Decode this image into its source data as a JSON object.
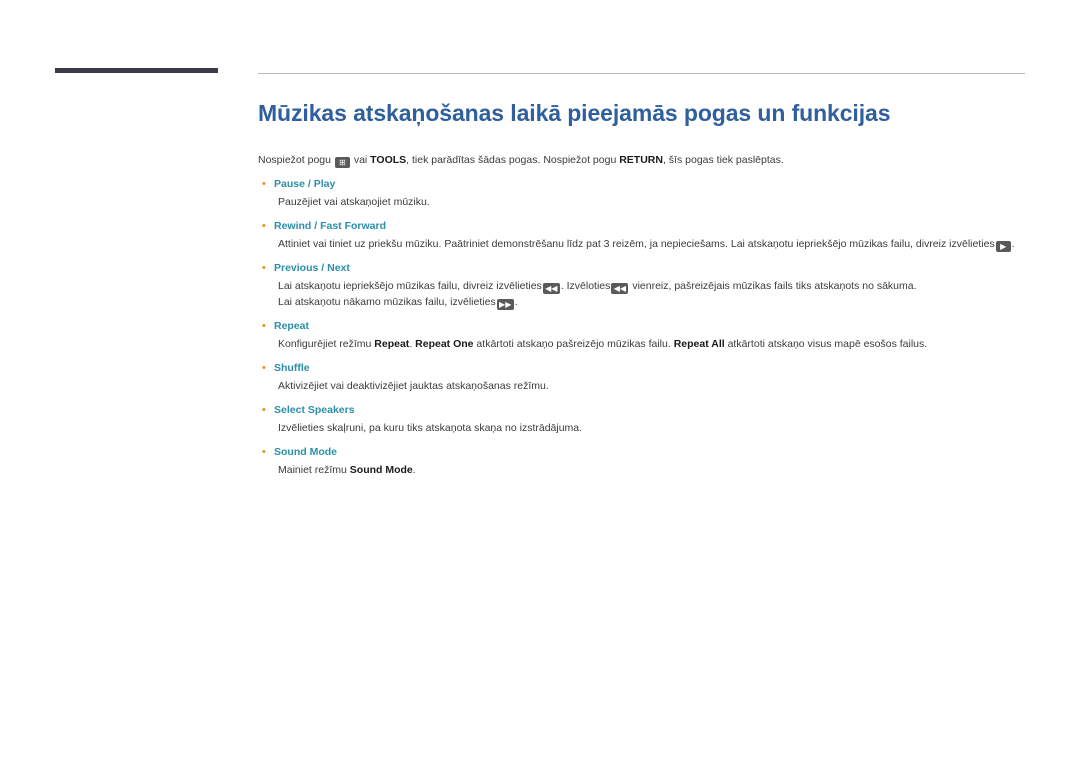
{
  "page": {
    "title": "Mūzikas atskaņošanas laikā pieejamās pogas un funkcijas",
    "intro_before": "Nospiežot pogu",
    "intro_key_1": "⊞",
    "intro_mid_1": "vai",
    "intro_bold_1": "TOOLS",
    "intro_mid_2": ", tiek parādītas šādas pogas. Nospiežot pogu",
    "intro_bold_2": "RETURN",
    "intro_after": ", šīs pogas tiek paslēptas.",
    "bullet_char": "•"
  },
  "items": [
    {
      "title": "Pause / Play",
      "lines": [
        {
          "text": "Pauzējiet vai atskaņojiet mūziku."
        }
      ]
    },
    {
      "title": "Rewind / Fast Forward",
      "lines": [
        {
          "text": "Attiniet vai tiniet uz priekšu mūziku. Paātriniet demonstrēšanu līdz pat 3 reizēm, ja nepieciešams. Lai atskaņotu iepriekšējo mūzikas failu, divreiz izvēlieties",
          "key": "▶",
          "tail": "."
        }
      ]
    },
    {
      "title": "Previous / Next",
      "lines": [
        {
          "text": "Lai atskaņotu iepriekšējo mūzikas failu, divreiz izvēlieties",
          "key": "◀◀",
          "mid": ". Izvēloties",
          "key2": "◀◀",
          "tail": " vienreiz, pašreizējais mūzikas fails tiks atskaņots no sākuma."
        },
        {
          "text": "Lai atskaņotu nākamo mūzikas failu, izvēlieties",
          "key": "▶▶",
          "tail": "."
        }
      ]
    },
    {
      "title": "Repeat",
      "lines": [
        {
          "text": "Konfigurējiet režīmu ",
          "bold1": "Repeat",
          "mid1": ". ",
          "bold2": "Repeat One",
          "mid2": " atkārtoti atskaņo pašreizējo mūzikas failu. ",
          "bold3": "Repeat All",
          "tail": " atkārtoti atskaņo visus mapē esošos failus."
        }
      ]
    },
    {
      "title": "Shuffle",
      "lines": [
        {
          "text": "Aktivizējiet vai deaktivizējiet jauktas atskaņošanas režīmu."
        }
      ]
    },
    {
      "title": "Select Speakers",
      "lines": [
        {
          "text": "Izvēlieties skaļruni, pa kuru tiks atskaņota skaņa no izstrādājuma."
        }
      ]
    },
    {
      "title": "Sound Mode",
      "lines": [
        {
          "text": "Mainiet režīmu ",
          "bold1": "Sound Mode",
          "tail": "."
        }
      ]
    }
  ]
}
